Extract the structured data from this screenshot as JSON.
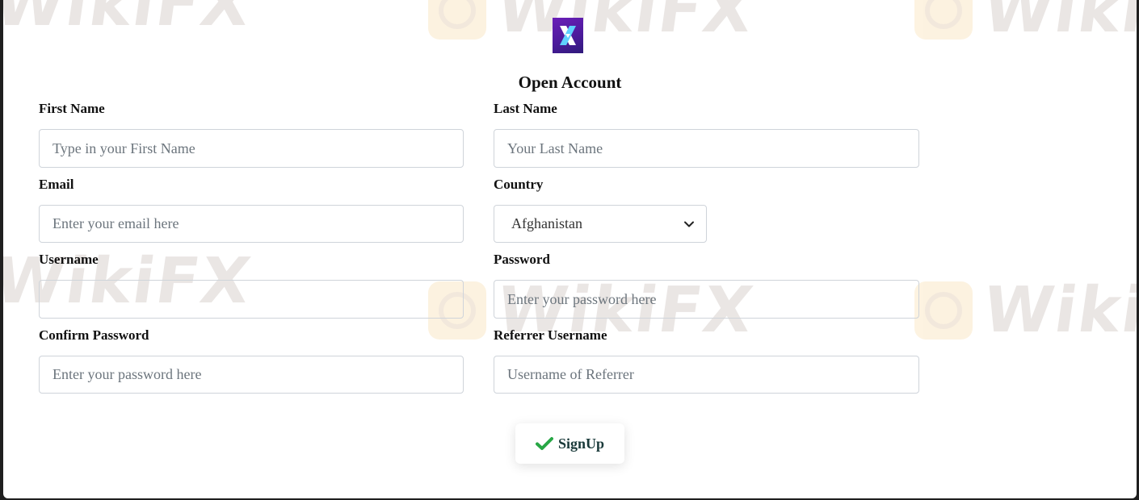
{
  "form": {
    "title": "Open Account",
    "first_name": {
      "label": "First Name",
      "placeholder": "Type in your First Name"
    },
    "last_name": {
      "label": "Last Name",
      "placeholder": "Your Last Name"
    },
    "email": {
      "label": "Email",
      "placeholder": "Enter your email here"
    },
    "country": {
      "label": "Country",
      "selected": "Afghanistan"
    },
    "username": {
      "label": "Username",
      "placeholder": ""
    },
    "password": {
      "label": "Password",
      "placeholder": "Enter your password here"
    },
    "confirm_password": {
      "label": "Confirm Password",
      "placeholder": "Enter your password here"
    },
    "referrer_username": {
      "label": "Referrer Username",
      "placeholder": "Username of Referrer"
    },
    "submit_label": "SignUp"
  },
  "watermark": {
    "text": "WikiFX"
  },
  "icons": {
    "logo": "x-logo",
    "submit": "check-icon",
    "select": "chevron-down-icon"
  },
  "colors": {
    "check": "#28a745",
    "logo_start": "#6b1fb8",
    "logo_end": "#2f1a7a"
  }
}
